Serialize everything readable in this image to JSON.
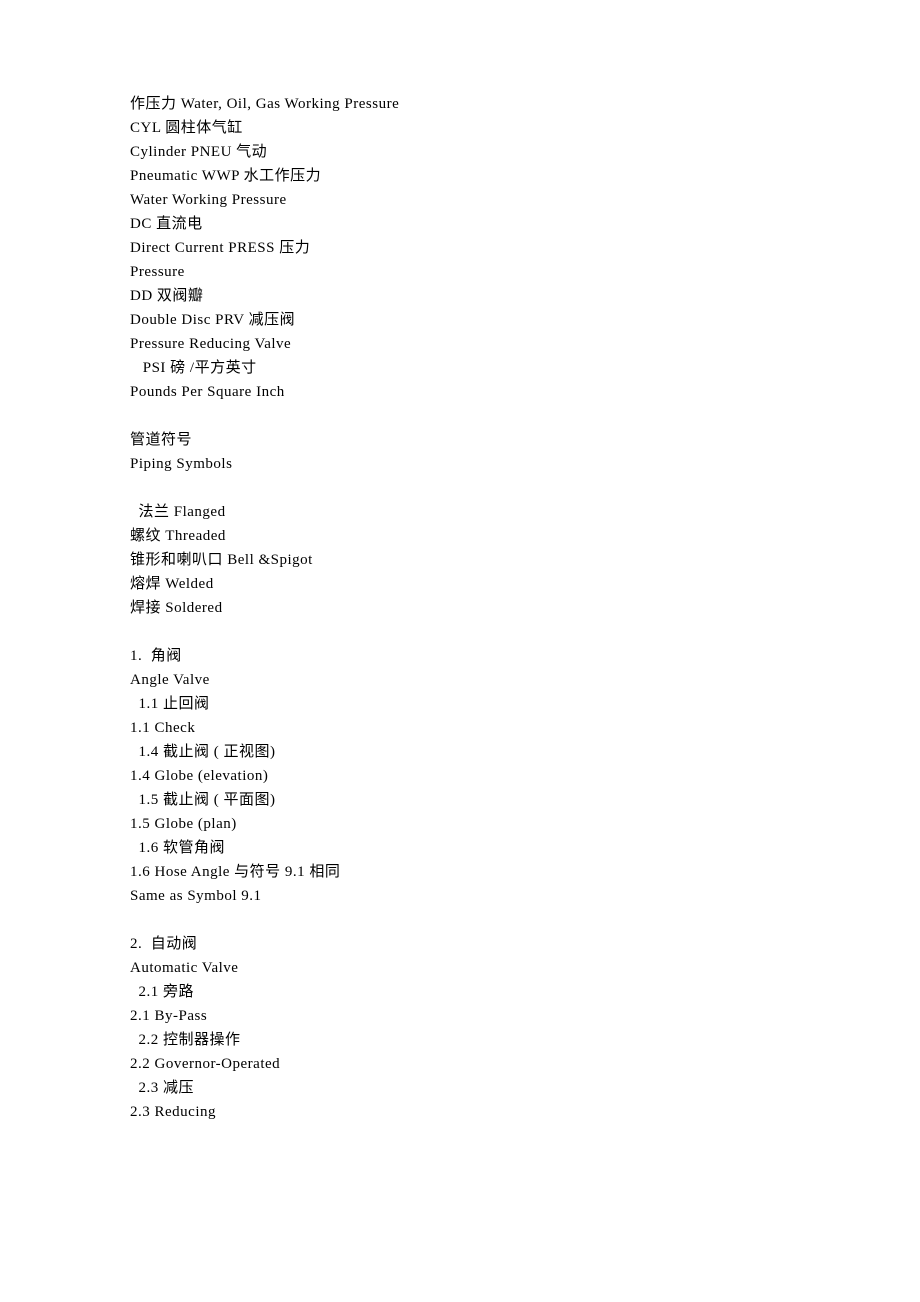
{
  "lines": [
    "作压力 Water, Oil, Gas Working Pressure",
    "CYL 圆柱体气缸",
    "Cylinder PNEU 气动",
    "Pneumatic WWP 水工作压力",
    "Water Working Pressure",
    "DC 直流电",
    "Direct Current PRESS 压力",
    "Pressure",
    "DD 双阀瓣",
    "Double Disc PRV 减压阀",
    "Pressure Reducing Valve",
    "   PSI 磅 /平方英寸",
    "Pounds Per Square Inch",
    "",
    "管道符号",
    "Piping Symbols",
    "",
    "  法兰 Flanged",
    "螺纹 Threaded",
    "锥形和喇叭口 Bell &Spigot",
    "熔焊 Welded",
    "焊接 Soldered",
    "",
    "1.  角阀",
    "Angle Valve",
    "  1.1 止回阀",
    "1.1 Check",
    "  1.4 截止阀 ( 正视图)",
    "1.4 Globe (elevation)",
    "  1.5 截止阀 ( 平面图)",
    "1.5 Globe (plan)",
    "  1.6 软管角阀",
    "1.6 Hose Angle 与符号 9.1 相同",
    "Same as Symbol 9.1",
    "",
    "2.  自动阀",
    "Automatic Valve",
    "  2.1 旁路",
    "2.1 By-Pass",
    "  2.2 控制器操作",
    "2.2 Governor-Operated",
    "  2.3 减压",
    "2.3 Reducing"
  ]
}
